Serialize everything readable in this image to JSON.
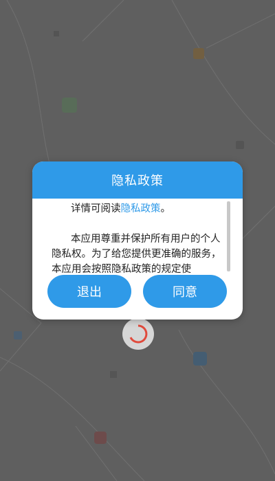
{
  "dialog": {
    "title": "隐私政策",
    "intro_text": "详情可阅读",
    "intro_link": "隐私政策",
    "intro_suffix": "。",
    "body_text": "本应用尊重并保护所有用户的个人隐私权。为了给您提供更准确的服务，本应用会按照隐私政策的规定使",
    "exit_label": "退出",
    "agree_label": "同意"
  },
  "colors": {
    "accent": "#2f9ae8",
    "spinner": "#e04a3c"
  }
}
